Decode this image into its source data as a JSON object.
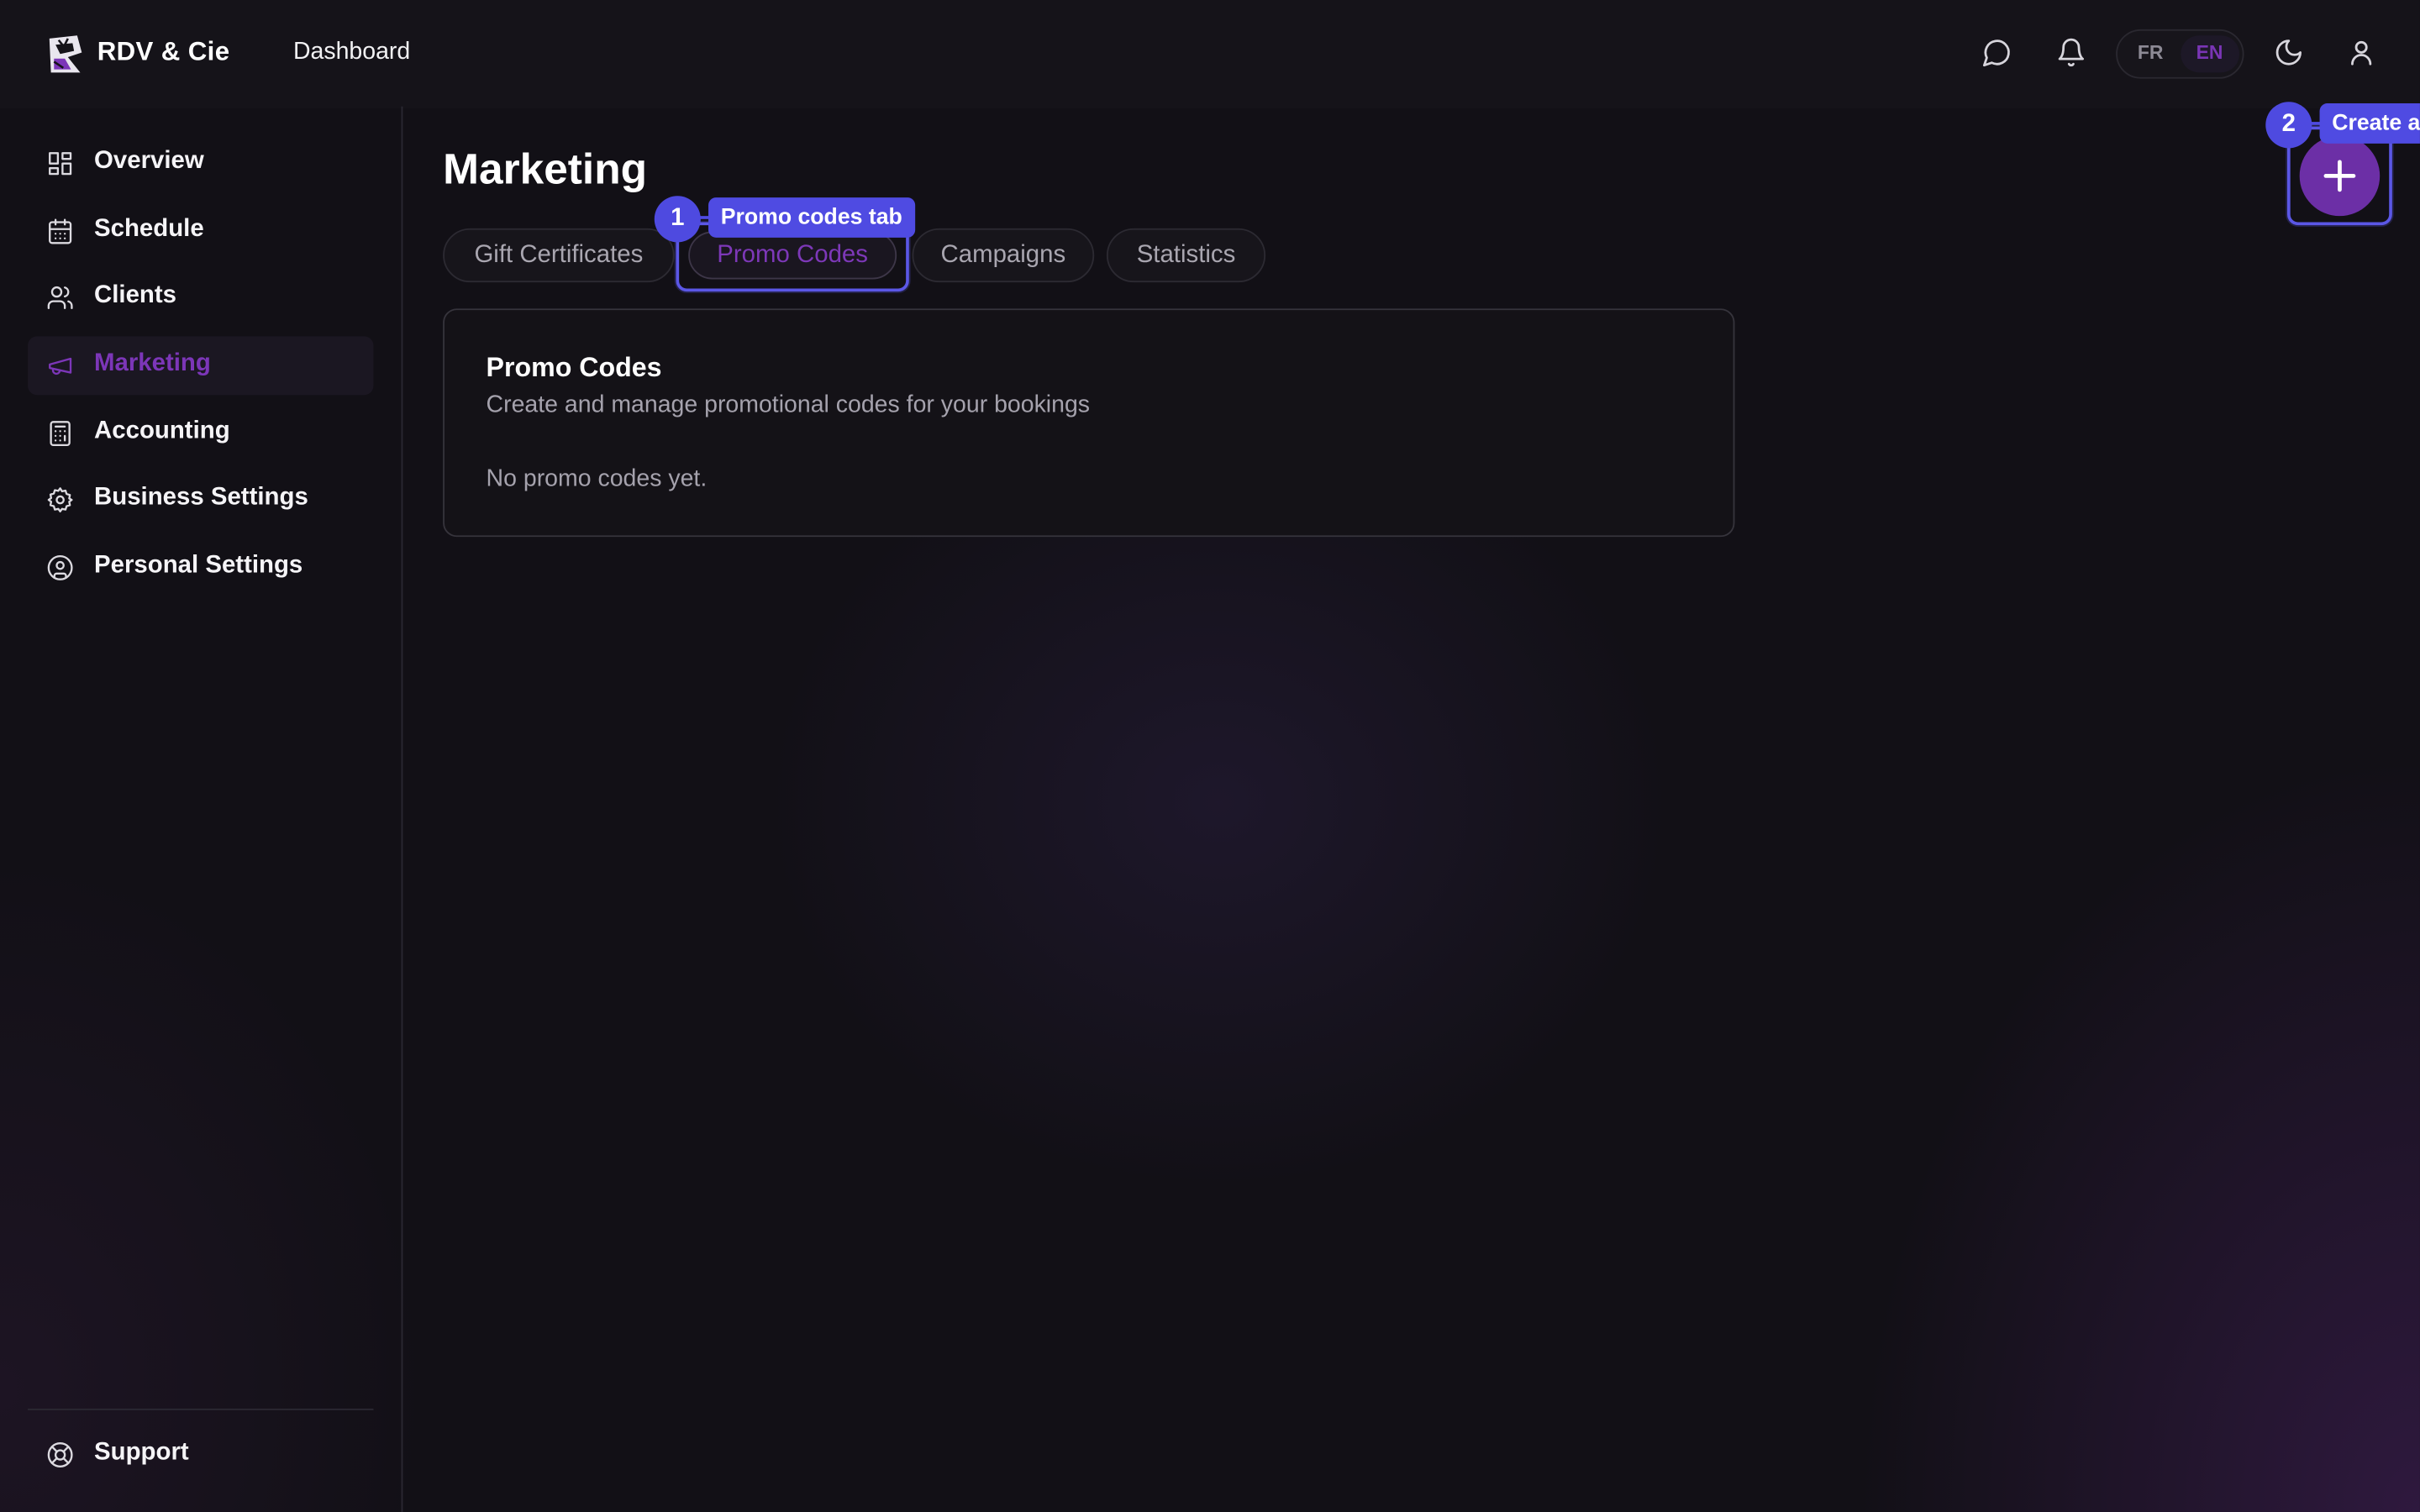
{
  "header": {
    "brand": "RDV & Cie",
    "nav_dashboard": "Dashboard",
    "icons": [
      "message-icon",
      "bell-icon",
      "moon-icon",
      "user-icon"
    ],
    "language": {
      "options": [
        "FR",
        "EN"
      ],
      "selected": "EN"
    }
  },
  "sidebar": {
    "items": [
      {
        "label": "Overview",
        "icon": "grid-icon",
        "active": false
      },
      {
        "label": "Schedule",
        "icon": "calendar-icon",
        "active": false
      },
      {
        "label": "Clients",
        "icon": "users-icon",
        "active": false
      },
      {
        "label": "Marketing",
        "icon": "megaphone-icon",
        "active": true
      },
      {
        "label": "Accounting",
        "icon": "calculator-icon",
        "active": false
      },
      {
        "label": "Business Settings",
        "icon": "gear-icon",
        "active": false
      },
      {
        "label": "Personal Settings",
        "icon": "user-circle-icon",
        "active": false
      }
    ],
    "support": {
      "label": "Support",
      "icon": "lifebuoy-icon"
    }
  },
  "main": {
    "title": "Marketing",
    "tabs": [
      {
        "label": "Gift Certificates",
        "active": false
      },
      {
        "label": "Promo Codes",
        "active": true
      },
      {
        "label": "Campaigns",
        "active": false
      },
      {
        "label": "Statistics",
        "active": false
      }
    ],
    "card": {
      "title": "Promo Codes",
      "subtitle": "Create and manage promotional codes for your bookings",
      "empty_text": "No promo codes yet."
    },
    "fab_icon": "plus-icon"
  },
  "annotations": [
    {
      "number": "1",
      "label": "Promo codes tab"
    },
    {
      "number": "2",
      "label": "Create a"
    }
  ],
  "colors": {
    "accent": "#7c36b8",
    "annotation": "#4f4be2",
    "background": "#121016"
  }
}
